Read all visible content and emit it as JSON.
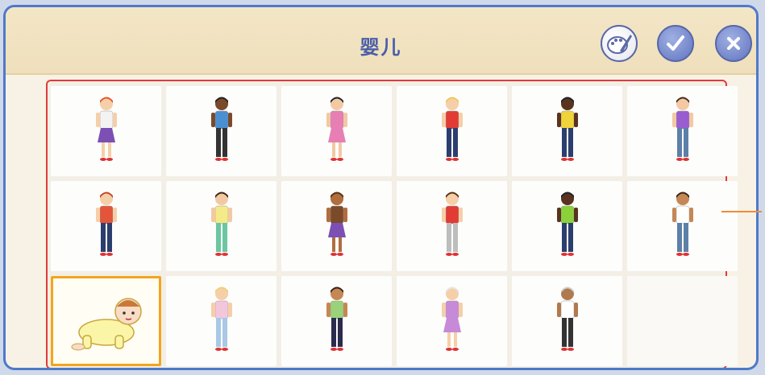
{
  "header": {
    "title": "婴儿"
  },
  "buttons": {
    "paint": "paint-brush-icon",
    "ok": "checkmark-icon",
    "close": "close-icon"
  },
  "colors": {
    "accent_blue": "#4f79c9",
    "selection_border": "#f2a51c",
    "grid_border": "#e13b3b"
  },
  "characters": [
    {
      "icon": "girl-red-hair-purple-skirt"
    },
    {
      "icon": "girl-braids-blue-shirt"
    },
    {
      "icon": "girl-pink-dress"
    },
    {
      "icon": "boy-blond-red-shirt"
    },
    {
      "icon": "boy-yellow-shirt"
    },
    {
      "icon": "boy-purple-shirt"
    },
    {
      "icon": "woman-red-shirt"
    },
    {
      "icon": "girl-yellow-shirt-green-shorts"
    },
    {
      "icon": "girl-long-hair-purple-skirt"
    },
    {
      "icon": "boy-red-shirt-grey-shorts"
    },
    {
      "icon": "man-green-shirt"
    },
    {
      "icon": "boy-white-shirt"
    },
    {
      "icon": "baby-crawling",
      "selected": true
    },
    {
      "icon": "woman-blond-walking"
    },
    {
      "icon": "man-walking-green-shirt"
    },
    {
      "icon": "grandma-purple-dress"
    },
    {
      "icon": "grandpa-white-shirt"
    },
    {
      "icon": "empty-slot"
    }
  ]
}
